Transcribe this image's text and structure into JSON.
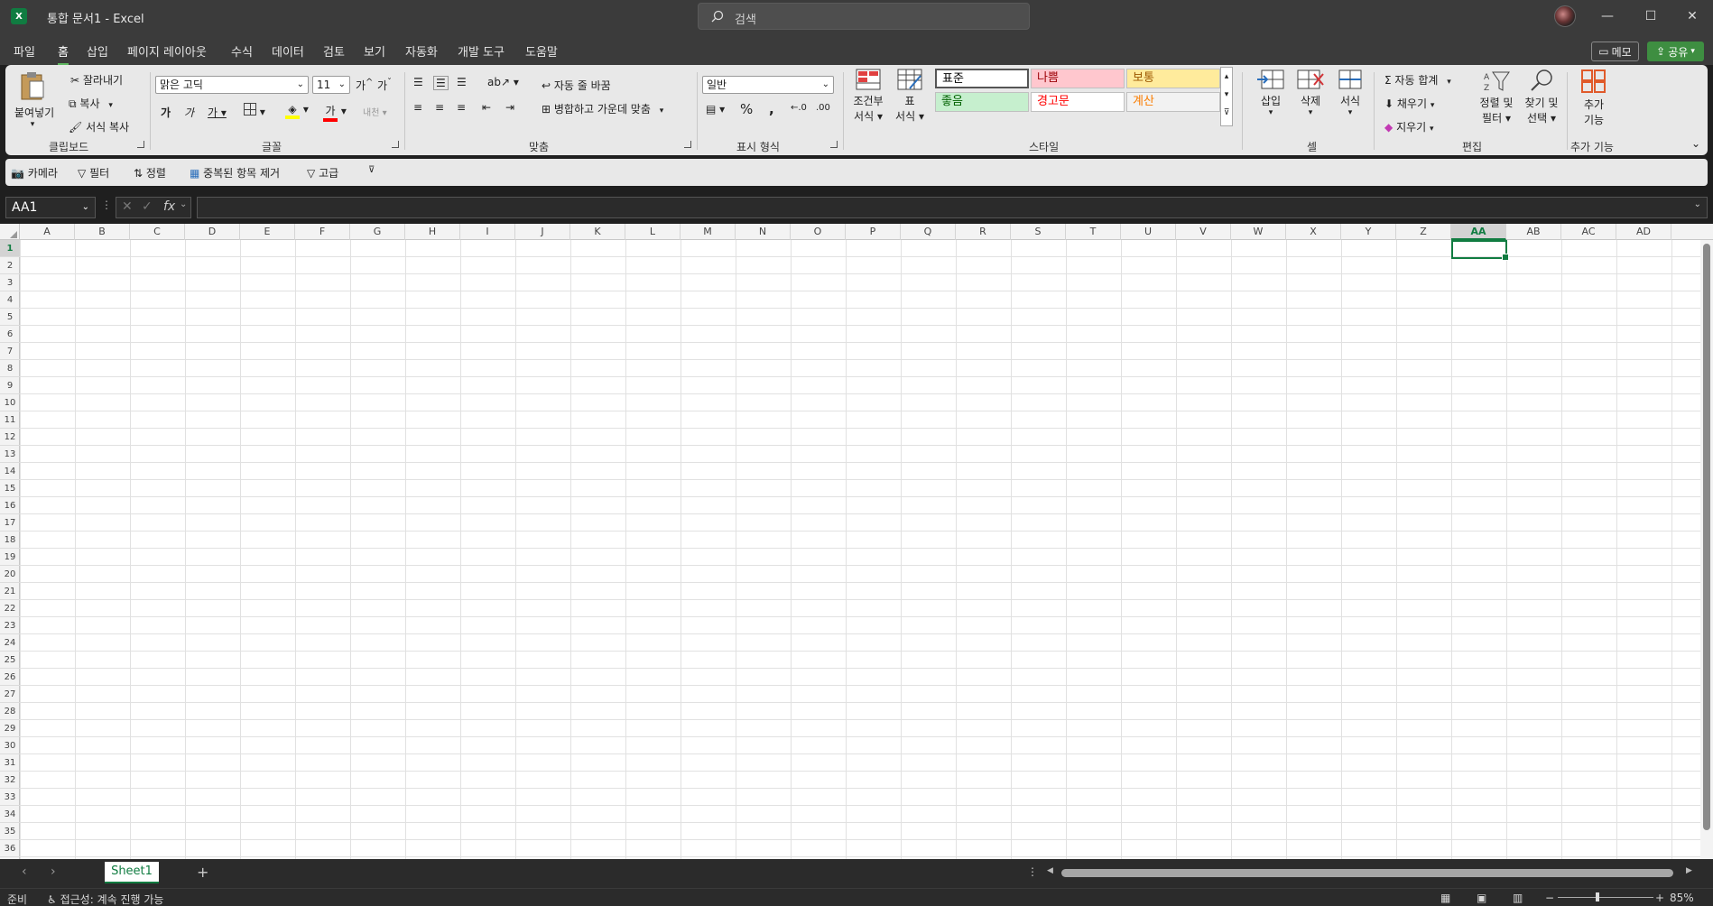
{
  "titlebar": {
    "app_icon": "excel-icon",
    "document_title": "통합 문서1  -  Excel",
    "search_placeholder": "검색"
  },
  "menu": {
    "items": [
      "파일",
      "홈",
      "삽입",
      "페이지 레이아웃",
      "수식",
      "데이터",
      "검토",
      "보기",
      "자동화",
      "개발 도구",
      "도움말"
    ],
    "active": "홈",
    "memo_label": "메모",
    "share_label": "공유"
  },
  "ribbon": {
    "clipboard": {
      "label": "클립보드",
      "paste": "붙여넣기",
      "cut": "잘라내기",
      "copy": "복사",
      "format_painter": "서식 복사"
    },
    "font": {
      "label": "글꼴",
      "font_name": "맑은 고딕",
      "font_size": "11"
    },
    "alignment": {
      "label": "맞춤",
      "wrap_text": "자동 줄 바꿈",
      "merge_center": "병합하고 가운데 맞춤"
    },
    "number": {
      "label": "표시 형식",
      "format": "일반"
    },
    "styles": {
      "label": "스타일",
      "conditional_line1": "조건부",
      "conditional_line2": "서식",
      "table_line1": "표",
      "table_line2": "서식",
      "cells": [
        {
          "text": "표준",
          "bg": "#ffffff",
          "fg": "#000000"
        },
        {
          "text": "나쁨",
          "bg": "#ffc7ce",
          "fg": "#9c0006"
        },
        {
          "text": "보통",
          "bg": "#ffeb9c",
          "fg": "#9c5700"
        },
        {
          "text": "좋음",
          "bg": "#c6efce",
          "fg": "#006100"
        },
        {
          "text": "경고문",
          "bg": "#ffffff",
          "fg": "#ff0000"
        },
        {
          "text": "계산",
          "bg": "#f2f2f2",
          "fg": "#fa7d00"
        }
      ]
    },
    "cells": {
      "label": "셀",
      "insert": "삽입",
      "delete": "삭제",
      "format": "서식"
    },
    "editing": {
      "label": "편집",
      "autosum": "자동 합계",
      "fill": "채우기",
      "clear": "지우기",
      "sort_line1": "정렬 및",
      "sort_line2": "필터",
      "find_line1": "찾기 및",
      "find_line2": "선택"
    },
    "addins": {
      "label": "추가 기능",
      "button_line1": "추가",
      "button_line2": "기능"
    }
  },
  "qat": {
    "camera": "카메라",
    "filter": "필터",
    "sort": "정렬",
    "remove_duplicates": "중복된 항목 제거",
    "advanced": "고급"
  },
  "formula_bar": {
    "name_box": "AA1",
    "fx": "fx",
    "value": ""
  },
  "grid": {
    "columns": [
      "A",
      "B",
      "C",
      "D",
      "E",
      "F",
      "G",
      "H",
      "I",
      "J",
      "K",
      "L",
      "M",
      "N",
      "O",
      "P",
      "Q",
      "R",
      "S",
      "T",
      "U",
      "V",
      "W",
      "X",
      "Y",
      "Z",
      "AA",
      "AB",
      "AC",
      "AD"
    ],
    "rows": [
      "1",
      "2",
      "3",
      "4",
      "5",
      "6",
      "7",
      "8",
      "9",
      "10",
      "11",
      "12",
      "13",
      "14",
      "15",
      "16",
      "17",
      "18",
      "19",
      "20",
      "21",
      "22",
      "23",
      "24",
      "25",
      "26",
      "27",
      "28",
      "29",
      "30",
      "31",
      "32",
      "33",
      "34",
      "35",
      "36"
    ],
    "selected_column": "AA",
    "selected_row": "1"
  },
  "sheets": {
    "tabs": [
      "Sheet1"
    ],
    "active": "Sheet1"
  },
  "status": {
    "ready": "준비",
    "accessibility": "접근성: 계속 진행 가능",
    "zoom": "85%"
  },
  "colors": {
    "accent": "#107c41",
    "share": "#3e8e41"
  }
}
